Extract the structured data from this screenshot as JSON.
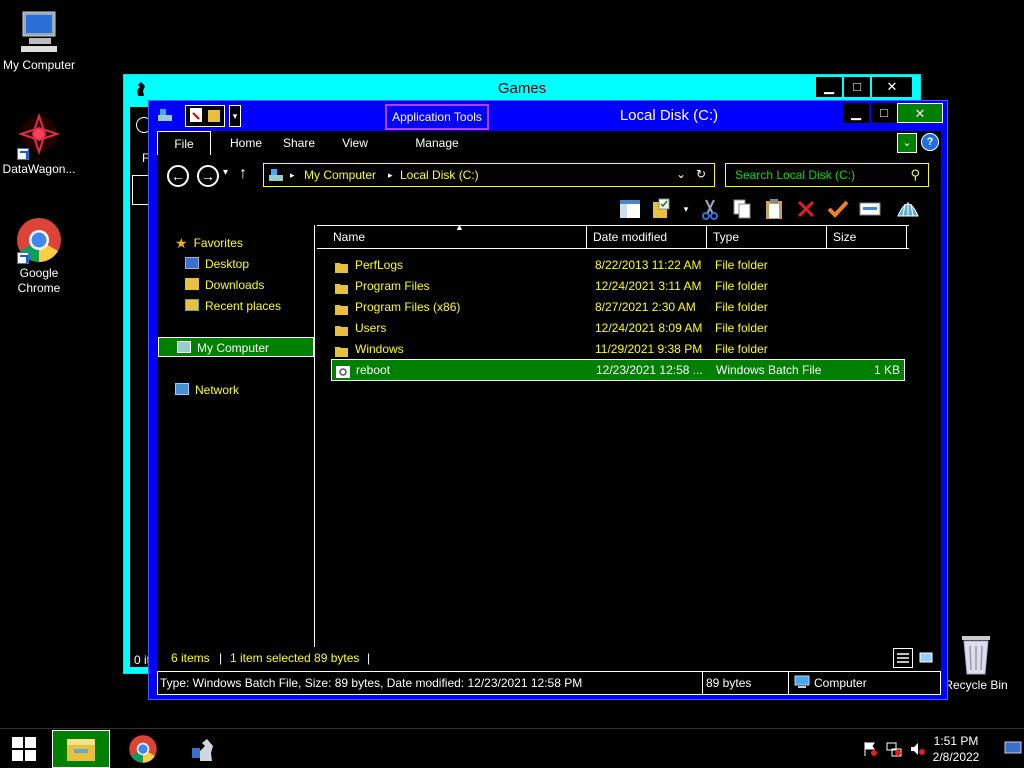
{
  "desktop": {
    "icons": [
      {
        "label": "My Computer"
      },
      {
        "label": "DataWagon..."
      },
      {
        "label": "Google Chrome"
      },
      {
        "label": "Recycle Bin"
      }
    ]
  },
  "games_window": {
    "title": "Games",
    "partial_texts": [
      "Fi",
      "0 it"
    ]
  },
  "explorer": {
    "context_tab": "Application Tools",
    "title": "Local Disk (C:)",
    "ribbon_tabs": [
      "File",
      "Home",
      "Share",
      "View",
      "Manage"
    ],
    "address": {
      "segments": [
        "My Computer",
        "Local Disk (C:)"
      ]
    },
    "search": {
      "placeholder": "Search Local Disk (C:)"
    },
    "nav": {
      "favorites": "Favorites",
      "desktop": "Desktop",
      "downloads": "Downloads",
      "recent": "Recent places",
      "my_computer": "My Computer",
      "network": "Network"
    },
    "columns": [
      "Name",
      "Date modified",
      "Type",
      "Size"
    ],
    "files": [
      {
        "name": "PerfLogs",
        "date": "8/22/2013 11:22 AM",
        "type": "File folder",
        "size": ""
      },
      {
        "name": "Program Files",
        "date": "12/24/2021 3:11 AM",
        "type": "File folder",
        "size": ""
      },
      {
        "name": "Program Files (x86)",
        "date": "8/27/2021 2:30 AM",
        "type": "File folder",
        "size": ""
      },
      {
        "name": "Users",
        "date": "12/24/2021 8:09 AM",
        "type": "File folder",
        "size": ""
      },
      {
        "name": "Windows",
        "date": "11/29/2021 9:38 PM",
        "type": "File folder",
        "size": ""
      },
      {
        "name": "reboot",
        "date": "12/23/2021 12:58 ...",
        "type": "Windows Batch File",
        "size": "1 KB"
      }
    ],
    "status": {
      "items": "6 items",
      "selected": "1 item selected  89 bytes"
    },
    "details": {
      "info": "Type: Windows Batch File, Size: 89 bytes, Date modified: 12/23/2021 12:58 PM",
      "size": "89 bytes",
      "location": "Computer"
    }
  },
  "taskbar": {
    "time": "1:51 PM",
    "date": "2/8/2022"
  },
  "colors": {
    "window_blue": "#0000ff",
    "games_cyan": "#00ffff",
    "selection_green": "#008000",
    "text_yellow": "#ffff00",
    "accent_purple": "#b040ff"
  }
}
